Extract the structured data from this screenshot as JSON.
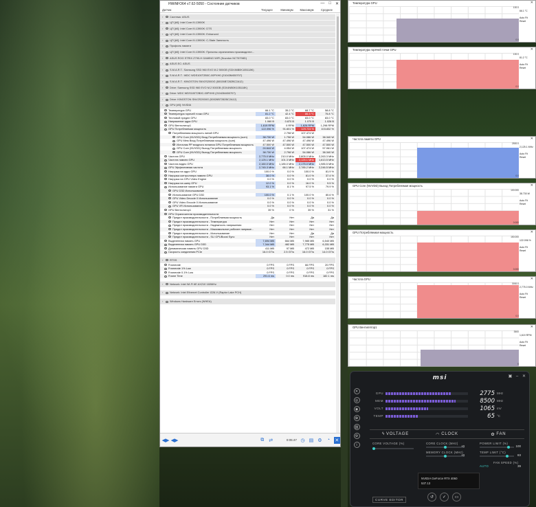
{
  "hwinfo": {
    "title": "HWiNFO64 v7.62-5050 - Состояние датчиков",
    "columns": [
      "Датчик",
      "Текущее",
      "Минимум",
      "Максимум",
      "Среднее"
    ],
    "time": "0:05:47",
    "rows": [
      {
        "t": "sec",
        "n": "Система: ASUS"
      },
      {
        "t": "sec",
        "n": "ЦП [#0]: Intel Core i9-13900K"
      },
      {
        "t": "sec",
        "n": "ЦП [#0]: Intel Core i9-13900K: DTS"
      },
      {
        "t": "sec",
        "n": "ЦП [#0]: Intel Core i9-13900K: Enhanced"
      },
      {
        "t": "sec",
        "n": "ЦП [#0]: Intel Core i9-13900K: C-State Занятость"
      },
      {
        "t": "sec",
        "n": "Профиль памяти"
      },
      {
        "t": "sec",
        "n": "ЦП [#0]: Intel Core i9-13900K: Причины ограничения производител..."
      },
      {
        "t": "sec",
        "n": "ASUS ROG STRIX Z790-H GAMING WIFI (Nuvoton NCT6798D)"
      },
      {
        "t": "sec",
        "n": "ASUS EC: ASUS"
      },
      {
        "t": "sec",
        "n": "S.M.A.R.T.: Samsung SSD 960 EVO M.2 500GB (S3X4NB0K105118K)"
      },
      {
        "t": "sec",
        "n": "S.M.A.R.T.: WDC WDS100T2B0C-00PXH0 (21043M450707)"
      },
      {
        "t": "sec",
        "n": "S.M.A.R.T.: KINGSTON SNV2S2000G (50026B7282BC2A12)"
      },
      {
        "t": "sec",
        "n": "Drive: Samsung SSD 960 EVO M.2 500GB (S3X4NB0K105118K)"
      },
      {
        "t": "sec",
        "n": "Drive: WDC WDS100T2B0C-00PXH0 (21043M450707)"
      },
      {
        "t": "sec",
        "n": "Drive: KINGSTON SNV2S2000G (50026B7282BC2A12)"
      },
      {
        "t": "sec",
        "n": "GPU [#0]: NVIDIA"
      },
      {
        "t": "r",
        "n": "Температура GPU",
        "c": "66.1 °C",
        "mn": "35.2 °C",
        "mx": "68.7 °C",
        "av": "58.8 °C"
      },
      {
        "t": "r",
        "n": "Температура горячей точки GPU",
        "c": "81.2 °C",
        "mn": "42.4 °C",
        "mx": "86.3 °C",
        "av": "75.8 °C",
        "hlc": true,
        "redmx": true
      },
      {
        "t": "r",
        "n": "Тепловой предел GPU",
        "c": "83.0 °C",
        "mn": "83.0 °C",
        "mx": "83.0 °C",
        "av": "83.0 °C"
      },
      {
        "t": "r",
        "n": "Напряжение ядра GPU",
        "c": "1.060 В",
        "mn": "0.870 В",
        "mx": "1.070 В",
        "av": "1.026 В"
      },
      {
        "t": "r",
        "n": "GPU Вентилятор1",
        "c": "1,619 RPM",
        "mn": "0 RPM",
        "mx": "1,626 RPM",
        "av": "1,298 RPM",
        "hlc": true,
        "hlmx": true
      },
      {
        "t": "r",
        "n": "GPU Потребляемая мощность",
        "c": "122.096 %",
        "mn": "91.601 %",
        "mx": "129.724 %",
        "av": "103.832 %",
        "hlc": true,
        "redmx": true
      },
      {
        "t": "sub",
        "n": "Потребляемая мощность линий GPU",
        "c": "",
        "mn": "2.798 W",
        "mx": "107.474 W",
        "av": ""
      },
      {
        "t": "sub2",
        "n": "GPU Core (NVVDD) Вход Потребляемая мощность (sum)",
        "c": "38.730 W",
        "mn": "1.798 W",
        "mx": "54.086 W",
        "av": "38.340 W",
        "hlc": true
      },
      {
        "t": "sub2",
        "n": "GPU Мем Вход Потребляемая мощность (sum)",
        "c": "47.496 W",
        "mn": "47.496 W",
        "mx": "47.496 W",
        "av": "47.496 W"
      },
      {
        "t": "sub2",
        "n": "Источник PP входного питания GPU Потребляемая мощность (sum)",
        "c": "47.500 W",
        "mn": "47.500 W",
        "mx": "47.500 W",
        "av": "47.500 W"
      },
      {
        "t": "sub2",
        "n": "GPU Core (NVVDD) Выход Потребляемая мощность",
        "c": "24.644 W",
        "mn": "4.054 W",
        "mx": "107.474 W",
        "av": "57.061 W",
        "hlc": true
      },
      {
        "t": "sub2",
        "n": "GPU Core (NVVDD) Выход Потребляемая мощность",
        "c": "38.730 W",
        "mn": "2.798 W",
        "mx": "54.086 W",
        "av": "38.340 W",
        "hlc": true
      },
      {
        "t": "r",
        "n": "Частота GPU",
        "c": "2,775.0 MHz",
        "mn": "210.0 MHz",
        "mx": "2,805.0 MHz",
        "av": "2,263.3 MHz",
        "hlc": true
      },
      {
        "t": "r",
        "n": "Частота памяти GPU",
        "c": "2,125.1 MHz",
        "mn": "101.3 MHz",
        "mx": "2,125.1 MHz",
        "av": "1,613.5 MHz",
        "hlc": true,
        "redmx": true
      },
      {
        "t": "r",
        "n": "Частота видео GPU",
        "c": "2,160.0 MHz",
        "mn": "1,185.0 MHz",
        "mx": "2,175.0 MHz",
        "av": "1,985.5 MHz",
        "hlc": true,
        "hlmx": true
      },
      {
        "t": "r",
        "n": "GPU Эффективная частота",
        "c": "2,745.3 MHz",
        "mn": "66.1 MHz",
        "mx": "2,785.2 MHz",
        "av": "2,246.5 MHz",
        "hlc": true
      },
      {
        "t": "r",
        "n": "Нагрузка на ядро GPU",
        "c": "100.0 %",
        "mn": "0.0 %",
        "mx": "100.0 %",
        "av": "81.9 %"
      },
      {
        "t": "r",
        "n": "Нагрузка контроллера памяти GPU",
        "c": "38.0 %",
        "mn": "0.0 %",
        "mx": "81.0 %",
        "av": "37.4 %",
        "hlc": true
      },
      {
        "t": "r",
        "n": "Нагрузка на GPU Video Engine",
        "c": "0.0 %",
        "mn": "0.0 %",
        "mx": "0.0 %",
        "av": "0.0 %"
      },
      {
        "t": "r",
        "n": "Нагрузка на шину GPU",
        "c": "12.0 %",
        "mn": "0.0 %",
        "mx": "16.0 %",
        "av": "9.5 %",
        "hlc": true
      },
      {
        "t": "r",
        "n": "Использование памяти GPU",
        "c": "93.1 %",
        "mn": "8.1 %",
        "mx": "97.5 %",
        "av": "79.9 %",
        "hlc": true
      },
      {
        "t": "sub",
        "n": "GPU D3D Использование",
        "c": "",
        "mn": "",
        "mx": "",
        "av": ""
      },
      {
        "t": "sub",
        "n": "Использование GPU D3D",
        "c": "100.0 %",
        "mn": "0.1 %",
        "mx": "100.0 %",
        "av": "80.6 %",
        "hlc": true
      },
      {
        "t": "sub",
        "n": "GPU Video Decode 0 Использование",
        "c": "0.0 %",
        "mn": "0.0 %",
        "mx": "0.0 %",
        "av": "0.0 %"
      },
      {
        "t": "sub",
        "n": "GPU Video Encode 0 Использование",
        "c": "0.0 %",
        "mn": "0.0 %",
        "mx": "0.0 %",
        "av": "0.0 %"
      },
      {
        "t": "sub",
        "n": "GPU VR Использование",
        "c": "0.0 %",
        "mn": "0.0 %",
        "mx": "0.0 %",
        "av": "0.0 %"
      },
      {
        "t": "r",
        "n": "GPU Вентилятор1",
        "c": "39 %",
        "mn": "0 %",
        "mx": "39 %",
        "av": "31 %"
      },
      {
        "t": "r",
        "n": "GPU Ограничители производительности",
        "c": "",
        "mn": "",
        "mx": "",
        "av": ""
      },
      {
        "t": "sub",
        "n": "Предел производительности - Потребляемая мощность",
        "c": "Да",
        "mn": "Нет",
        "mx": "Да",
        "av": "Да"
      },
      {
        "t": "sub",
        "n": "Предел производительности - Температура",
        "c": "Нет",
        "mn": "Нет",
        "mx": "Нет",
        "av": "Нет"
      },
      {
        "t": "sub",
        "n": "Предел производительности - Надежность напряжения",
        "c": "Нет",
        "mn": "Нет",
        "mx": "Нет",
        "av": "Нет"
      },
      {
        "t": "sub",
        "n": "Предел производительности - Максимальное рабочее напряже...",
        "c": "Нет",
        "mn": "Нет",
        "mx": "Нет",
        "av": "Нет"
      },
      {
        "t": "sub",
        "n": "Предел производительности - Использование",
        "c": "Нет",
        "mn": "Нет",
        "mx": "Да",
        "av": "Да"
      },
      {
        "t": "sub",
        "n": "Предел производительности - SLI GPUBoost Sync",
        "c": "Нет",
        "mn": "Нет",
        "mx": "Нет",
        "av": "Нет"
      },
      {
        "t": "r",
        "n": "Выделенная память GPU",
        "c": "7,694 MB",
        "mn": "664 MB",
        "mx": "7,985 MB",
        "av": "6,540 MB",
        "hlc": true
      },
      {
        "t": "r",
        "n": "Выделенная память GPU D3D",
        "c": "7,344 MB",
        "mn": "482 MB",
        "mx": "7,775 MB",
        "av": "6,331 MB",
        "hlc": true
      },
      {
        "t": "r",
        "n": "Динамическая память GPU D3D",
        "c": "411 MB",
        "mn": "97 MB",
        "mx": "472 MB",
        "av": "155 MB"
      },
      {
        "t": "r",
        "n": "Скорость соединения PCIe",
        "c": "16.0 GT/s",
        "mn": "2.5 GT/s",
        "mx": "16.0 GT/s",
        "av": "14.0 GT/s"
      },
      {
        "t": "sp"
      },
      {
        "t": "sec",
        "n": "RTSS"
      },
      {
        "t": "r",
        "n": "Framerate",
        "c": "0 FPS",
        "mn": "0 FPS",
        "mx": "66 FPS",
        "av": "20 FPS"
      },
      {
        "t": "r",
        "n": "Framerate 1% Low",
        "c": "0 FPS",
        "mn": "0 FPS",
        "mx": "0 FPS",
        "av": "0 FPS"
      },
      {
        "t": "r",
        "n": "Framerate 0.1% Low",
        "c": "0 FPS",
        "mn": "0 FPS",
        "mx": "0 FPS",
        "av": "0 FPS"
      },
      {
        "t": "r",
        "n": "Frame Time",
        "c": "291.6 ms",
        "mn": "0.0 ms",
        "mx": "918.8 ms",
        "av": "182.1 ms",
        "hlc": true
      },
      {
        "t": "sp"
      },
      {
        "t": "sec",
        "n": "Network: Intel Wi-Fi 6E AX210 160MHz"
      },
      {
        "t": "sp"
      },
      {
        "t": "sec",
        "n": "Network: Intel Ethernet Controller I226-V (Raptor Lake PCH)"
      },
      {
        "t": "sp"
      },
      {
        "t": "sec",
        "n": "Windows Hardware Errors (WHEA)"
      }
    ]
  },
  "graphs": [
    {
      "title": "Температура GPU",
      "max": "100.0",
      "min": "0.0",
      "side": [
        "",
        "66.1 °C",
        "",
        "Auto Fit",
        "Reset"
      ],
      "color": "#a8a0b8",
      "level": 0.661,
      "start": 0.28
    },
    {
      "title": "Температура горячей точки GPU",
      "max": "100.0",
      "min": "0.0",
      "side": [
        "",
        "81.2 °C",
        "",
        "Auto Fit",
        "Reset"
      ],
      "color": "#f08c8c",
      "level": 0.812,
      "start": 0.28
    },
    {
      "title": "Частота памяти GPU",
      "max": "2500.0",
      "min": "0.0",
      "side": [
        "",
        "2,125.1 MHz",
        "",
        "Auto Fit",
        "Reset"
      ],
      "color": "#7a9ae6",
      "level": 0.85,
      "start": 0.4
    },
    {
      "title": "GPU Core (NVVDD) Выход Потребляемая мощность",
      "max": "100.000",
      "min": "0.000",
      "side": [
        "",
        "38.730 W",
        "",
        "Auto Fit",
        "Reset"
      ],
      "color": "#f08c8c",
      "level": 0.39,
      "start": 0.4
    },
    {
      "title": "GPU Потребляемая мощность",
      "max": "150.000",
      "min": "0.000",
      "side": [
        "",
        "122.096 %",
        "",
        "Auto Fit",
        "Reset"
      ],
      "color": "#f08c8c",
      "level": 0.81,
      "start": 0.4
    },
    {
      "title": "Частота GPU",
      "max": "3000.0",
      "min": "0.0",
      "side": [
        "",
        "2,775.0 MHz",
        "",
        "Auto Fit",
        "Reset"
      ],
      "color": "#f08c8c",
      "level": 0.92,
      "start": 0.4
    },
    {
      "title": "GPU Вентилятор1",
      "max": "3500",
      "min": "0",
      "side": [
        "",
        "1,619 RPM",
        "",
        "Auto Fit",
        "Reset"
      ],
      "color": "#a8a0b8",
      "level": 0.46,
      "start": 0.42
    }
  ],
  "afterburner": {
    "brand": "msi",
    "meters": [
      {
        "label": "GPU",
        "value": "2775",
        "unit": "MHz",
        "fill": 0.79
      },
      {
        "label": "MEM",
        "value": "8500",
        "unit": "MHz",
        "fill": 0.85
      },
      {
        "label": "VOLT",
        "value": "1065",
        "unit": "mV",
        "fill": 0.52
      },
      {
        "label": "TEMP",
        "value": "65",
        "unit": "°C",
        "fill": 0.4
      }
    ],
    "tabs": [
      "VOLTAGE",
      "CLOCK",
      "FAN"
    ],
    "core_voltage_label": "CORE VOLTAGE (%)",
    "core_clock_label": "CORE CLOCK (MHz)",
    "memory_clock_label": "MEMORY CLOCK (MHz)",
    "power_limit_label": "POWER LIMIT (%)",
    "temp_limit_label": "TEMP LIMIT (°C)",
    "fan_speed_label": "FAN SPEED (%)",
    "core_clock_value": "+0",
    "memory_clock_value": "+0",
    "power_limit_value": "100",
    "temp_limit_value": "83",
    "fan_speed_value": "39",
    "gpu_name": "NVIDIA GeForce RTX 4060",
    "driver": "537.13",
    "curve_editor": "CURVE EDITOR",
    "fan_mode": "AUTO"
  }
}
